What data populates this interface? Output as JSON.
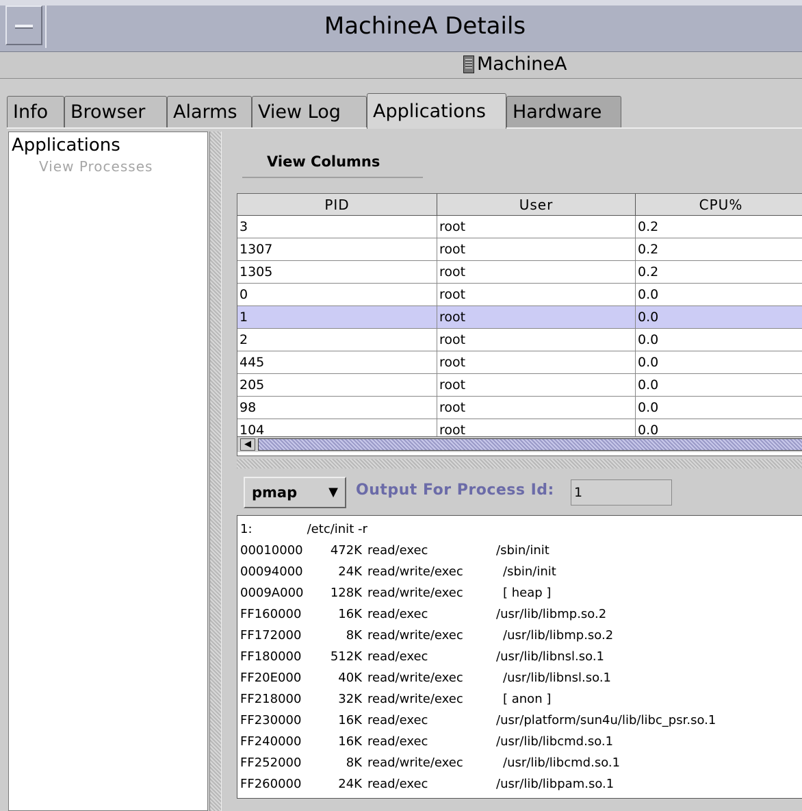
{
  "window": {
    "title": "MachineA Details",
    "machine_name": "MachineA",
    "colors": {
      "titlebar": "#aeb2c3",
      "selected_row": "#ccccf5",
      "label_accent": "#6b6ba8"
    }
  },
  "tabs": [
    {
      "label": "Info"
    },
    {
      "label": "Browser"
    },
    {
      "label": "Alarms"
    },
    {
      "label": "View Log"
    },
    {
      "label": "Applications",
      "active": true
    },
    {
      "label": "Hardware"
    }
  ],
  "tree": {
    "root": "Applications",
    "child": "View Processes"
  },
  "view_columns_label": "View Columns",
  "table": {
    "columns": [
      "PID",
      "User",
      "CPU%"
    ],
    "rows": [
      [
        "3",
        "root",
        "0.2"
      ],
      [
        "1307",
        "root",
        "0.2"
      ],
      [
        "1305",
        "root",
        "0.2"
      ],
      [
        "0",
        "root",
        "0.0"
      ],
      [
        "1",
        "root",
        "0.0"
      ],
      [
        "2",
        "root",
        "0.0"
      ],
      [
        "445",
        "root",
        "0.0"
      ],
      [
        "205",
        "root",
        "0.0"
      ],
      [
        "98",
        "root",
        "0.0"
      ],
      [
        "104",
        "root",
        "0.0"
      ]
    ],
    "selected_pid": "1"
  },
  "output": {
    "command": "pmap",
    "label": "Output For Process Id:",
    "process_id": "1",
    "header": "1:              /etc/init -r",
    "lines": [
      [
        "00010000",
        "472K",
        "read/exec",
        "/sbin/init"
      ],
      [
        "00094000",
        "24K",
        "read/write/exec",
        "/sbin/init"
      ],
      [
        "0009A000",
        "128K",
        "read/write/exec",
        "[ heap ]"
      ],
      [
        "FF160000",
        "16K",
        "read/exec",
        "/usr/lib/libmp.so.2"
      ],
      [
        "FF172000",
        "8K",
        "read/write/exec",
        "/usr/lib/libmp.so.2"
      ],
      [
        "FF180000",
        "512K",
        "read/exec",
        "/usr/lib/libnsl.so.1"
      ],
      [
        "FF20E000",
        "40K",
        "read/write/exec",
        "/usr/lib/libnsl.so.1"
      ],
      [
        "FF218000",
        "32K",
        "read/write/exec",
        "[ anon ]"
      ],
      [
        "FF230000",
        "16K",
        "read/exec",
        "/usr/platform/sun4u/lib/libc_psr.so.1"
      ],
      [
        "FF240000",
        "16K",
        "read/exec",
        "/usr/lib/libcmd.so.1"
      ],
      [
        "FF252000",
        "8K",
        "read/write/exec",
        "/usr/lib/libcmd.so.1"
      ],
      [
        "FF260000",
        "24K",
        "read/exec",
        "/usr/lib/libpam.so.1"
      ]
    ]
  }
}
